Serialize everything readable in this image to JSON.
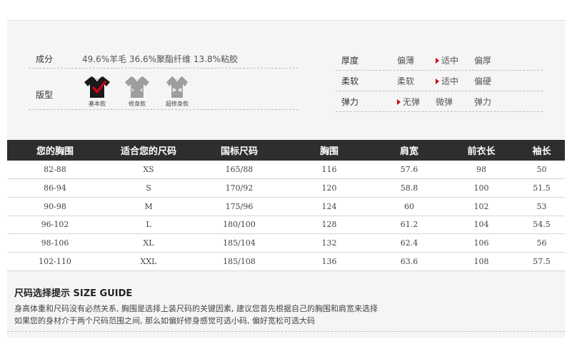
{
  "info": {
    "material_label": "成分",
    "material_value": "49.6%羊毛 36.6%聚酯纤维 13.8%粘胶",
    "fit_label": "版型",
    "fits": [
      {
        "caption": "基本款",
        "icon": "shirt-selected-icon"
      },
      {
        "caption": "修身款",
        "icon": "shirt-slim-icon"
      },
      {
        "caption": "超修身款",
        "icon": "shirt-superslim-icon"
      }
    ]
  },
  "properties": [
    {
      "label": "厚度",
      "options": [
        "偏薄",
        "适中",
        "偏厚"
      ],
      "selected": "适中"
    },
    {
      "label": "柔软",
      "options": [
        "柔软",
        "适中",
        "偏硬"
      ],
      "selected": "适中"
    },
    {
      "label": "弹力",
      "options": [
        "无弹",
        "微弹",
        "弹力"
      ],
      "selected": "无弹"
    }
  ],
  "table": {
    "headers": [
      "您的胸围",
      "适合您的尺码",
      "国标尺码",
      "胸围",
      "肩宽",
      "前衣长",
      "袖长"
    ],
    "rows": [
      [
        "82-88",
        "XS",
        "165/88",
        "116",
        "57.6",
        "98",
        "50"
      ],
      [
        "86-94",
        "S",
        "170/92",
        "120",
        "58.8",
        "100",
        "51.5"
      ],
      [
        "90-98",
        "M",
        "175/96",
        "124",
        "60",
        "102",
        "53"
      ],
      [
        "96-102",
        "L",
        "180/100",
        "128",
        "61.2",
        "104",
        "54.5"
      ],
      [
        "98-106",
        "XL",
        "185/104",
        "132",
        "62.4",
        "106",
        "56"
      ],
      [
        "102-110",
        "XXL",
        "185/108",
        "136",
        "63.6",
        "108",
        "57.5"
      ]
    ]
  },
  "guide": {
    "title": "尺码选择提示 SIZE GUIDE",
    "line1": "身高体重和尺码没有必然关系, 胸围是选择上装尺码的关键因素, 建议您首先根据自己的胸围和肩宽来选择",
    "line2": "如果您的身材介于两个尺码范围之间, 那么如偏好修身感觉可选小码, 偏好宽松可选大码"
  },
  "colors": {
    "header_bg": "#2e2e2e",
    "marker": "#d0021b",
    "check": "#d0021b"
  }
}
